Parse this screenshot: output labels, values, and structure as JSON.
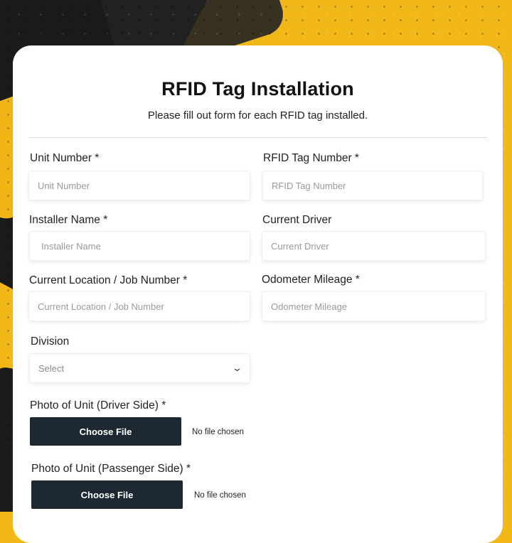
{
  "form": {
    "title": "RFID Tag Installation",
    "subtitle": "Please fill out form for each RFID tag installed.",
    "fields": {
      "unit_number": {
        "label": "Unit Number *",
        "placeholder": "Unit Number",
        "value": ""
      },
      "rfid_tag_number": {
        "label": "RFID Tag Number *",
        "placeholder": "RFID Tag Number",
        "value": ""
      },
      "installer_name": {
        "label": "Installer Name *",
        "placeholder": "Installer Name",
        "value": ""
      },
      "current_driver": {
        "label": "Current Driver",
        "placeholder": "Current Driver",
        "value": ""
      },
      "current_location": {
        "label": "Current Location / Job Number *",
        "placeholder": "Current Location / Job Number",
        "value": ""
      },
      "odometer": {
        "label": "Odometer Mileage *",
        "placeholder": "Odometer Mileage",
        "value": ""
      },
      "division": {
        "label": "Division",
        "selected": "Select"
      },
      "photo_driver": {
        "label": "Photo of Unit (Driver Side) *",
        "button": "Choose File",
        "status": "No file chosen"
      },
      "photo_passenger": {
        "label": "Photo of Unit (Passenger Side) *",
        "button": "Choose File",
        "status": "No file chosen"
      }
    }
  },
  "icons": {
    "dropdown": "chevron-down-icon"
  },
  "colors": {
    "accent_background": "#f2b818",
    "button_dark": "#1d2832"
  }
}
